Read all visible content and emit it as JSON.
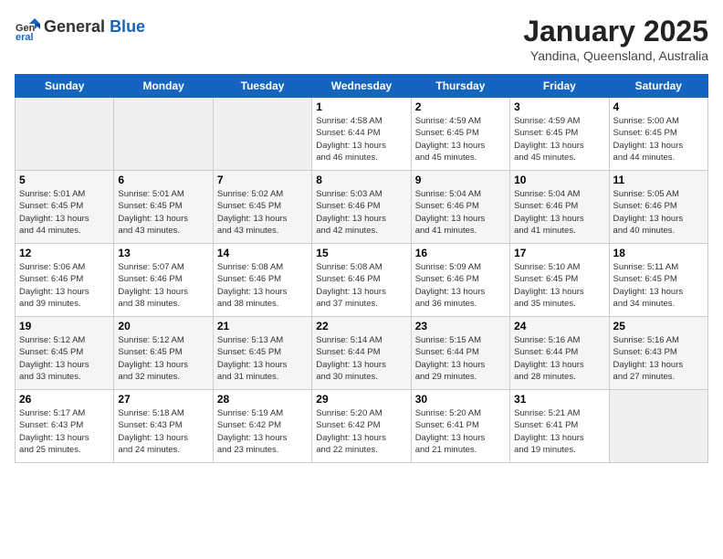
{
  "header": {
    "logo_general": "General",
    "logo_blue": "Blue",
    "title": "January 2025",
    "location": "Yandina, Queensland, Australia"
  },
  "weekdays": [
    "Sunday",
    "Monday",
    "Tuesday",
    "Wednesday",
    "Thursday",
    "Friday",
    "Saturday"
  ],
  "weeks": [
    {
      "days": [
        {
          "num": "",
          "info": "",
          "empty": true
        },
        {
          "num": "",
          "info": "",
          "empty": true
        },
        {
          "num": "",
          "info": "",
          "empty": true
        },
        {
          "num": "1",
          "info": "Sunrise: 4:58 AM\nSunset: 6:44 PM\nDaylight: 13 hours\nand 46 minutes.",
          "empty": false
        },
        {
          "num": "2",
          "info": "Sunrise: 4:59 AM\nSunset: 6:45 PM\nDaylight: 13 hours\nand 45 minutes.",
          "empty": false
        },
        {
          "num": "3",
          "info": "Sunrise: 4:59 AM\nSunset: 6:45 PM\nDaylight: 13 hours\nand 45 minutes.",
          "empty": false
        },
        {
          "num": "4",
          "info": "Sunrise: 5:00 AM\nSunset: 6:45 PM\nDaylight: 13 hours\nand 44 minutes.",
          "empty": false
        }
      ]
    },
    {
      "days": [
        {
          "num": "5",
          "info": "Sunrise: 5:01 AM\nSunset: 6:45 PM\nDaylight: 13 hours\nand 44 minutes.",
          "empty": false
        },
        {
          "num": "6",
          "info": "Sunrise: 5:01 AM\nSunset: 6:45 PM\nDaylight: 13 hours\nand 43 minutes.",
          "empty": false
        },
        {
          "num": "7",
          "info": "Sunrise: 5:02 AM\nSunset: 6:45 PM\nDaylight: 13 hours\nand 43 minutes.",
          "empty": false
        },
        {
          "num": "8",
          "info": "Sunrise: 5:03 AM\nSunset: 6:46 PM\nDaylight: 13 hours\nand 42 minutes.",
          "empty": false
        },
        {
          "num": "9",
          "info": "Sunrise: 5:04 AM\nSunset: 6:46 PM\nDaylight: 13 hours\nand 41 minutes.",
          "empty": false
        },
        {
          "num": "10",
          "info": "Sunrise: 5:04 AM\nSunset: 6:46 PM\nDaylight: 13 hours\nand 41 minutes.",
          "empty": false
        },
        {
          "num": "11",
          "info": "Sunrise: 5:05 AM\nSunset: 6:46 PM\nDaylight: 13 hours\nand 40 minutes.",
          "empty": false
        }
      ]
    },
    {
      "days": [
        {
          "num": "12",
          "info": "Sunrise: 5:06 AM\nSunset: 6:46 PM\nDaylight: 13 hours\nand 39 minutes.",
          "empty": false
        },
        {
          "num": "13",
          "info": "Sunrise: 5:07 AM\nSunset: 6:46 PM\nDaylight: 13 hours\nand 38 minutes.",
          "empty": false
        },
        {
          "num": "14",
          "info": "Sunrise: 5:08 AM\nSunset: 6:46 PM\nDaylight: 13 hours\nand 38 minutes.",
          "empty": false
        },
        {
          "num": "15",
          "info": "Sunrise: 5:08 AM\nSunset: 6:46 PM\nDaylight: 13 hours\nand 37 minutes.",
          "empty": false
        },
        {
          "num": "16",
          "info": "Sunrise: 5:09 AM\nSunset: 6:46 PM\nDaylight: 13 hours\nand 36 minutes.",
          "empty": false
        },
        {
          "num": "17",
          "info": "Sunrise: 5:10 AM\nSunset: 6:45 PM\nDaylight: 13 hours\nand 35 minutes.",
          "empty": false
        },
        {
          "num": "18",
          "info": "Sunrise: 5:11 AM\nSunset: 6:45 PM\nDaylight: 13 hours\nand 34 minutes.",
          "empty": false
        }
      ]
    },
    {
      "days": [
        {
          "num": "19",
          "info": "Sunrise: 5:12 AM\nSunset: 6:45 PM\nDaylight: 13 hours\nand 33 minutes.",
          "empty": false
        },
        {
          "num": "20",
          "info": "Sunrise: 5:12 AM\nSunset: 6:45 PM\nDaylight: 13 hours\nand 32 minutes.",
          "empty": false
        },
        {
          "num": "21",
          "info": "Sunrise: 5:13 AM\nSunset: 6:45 PM\nDaylight: 13 hours\nand 31 minutes.",
          "empty": false
        },
        {
          "num": "22",
          "info": "Sunrise: 5:14 AM\nSunset: 6:44 PM\nDaylight: 13 hours\nand 30 minutes.",
          "empty": false
        },
        {
          "num": "23",
          "info": "Sunrise: 5:15 AM\nSunset: 6:44 PM\nDaylight: 13 hours\nand 29 minutes.",
          "empty": false
        },
        {
          "num": "24",
          "info": "Sunrise: 5:16 AM\nSunset: 6:44 PM\nDaylight: 13 hours\nand 28 minutes.",
          "empty": false
        },
        {
          "num": "25",
          "info": "Sunrise: 5:16 AM\nSunset: 6:43 PM\nDaylight: 13 hours\nand 27 minutes.",
          "empty": false
        }
      ]
    },
    {
      "days": [
        {
          "num": "26",
          "info": "Sunrise: 5:17 AM\nSunset: 6:43 PM\nDaylight: 13 hours\nand 25 minutes.",
          "empty": false
        },
        {
          "num": "27",
          "info": "Sunrise: 5:18 AM\nSunset: 6:43 PM\nDaylight: 13 hours\nand 24 minutes.",
          "empty": false
        },
        {
          "num": "28",
          "info": "Sunrise: 5:19 AM\nSunset: 6:42 PM\nDaylight: 13 hours\nand 23 minutes.",
          "empty": false
        },
        {
          "num": "29",
          "info": "Sunrise: 5:20 AM\nSunset: 6:42 PM\nDaylight: 13 hours\nand 22 minutes.",
          "empty": false
        },
        {
          "num": "30",
          "info": "Sunrise: 5:20 AM\nSunset: 6:41 PM\nDaylight: 13 hours\nand 21 minutes.",
          "empty": false
        },
        {
          "num": "31",
          "info": "Sunrise: 5:21 AM\nSunset: 6:41 PM\nDaylight: 13 hours\nand 19 minutes.",
          "empty": false
        },
        {
          "num": "",
          "info": "",
          "empty": true
        }
      ]
    }
  ]
}
